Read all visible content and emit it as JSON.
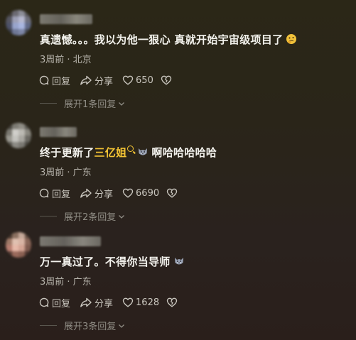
{
  "comments": [
    {
      "text": "真遗憾。。。我以为他一狠心 真就开始宇宙级项目了",
      "emoji": "thinking-face-emoji",
      "meta": "3周前 · 北京",
      "reply_label": "回复",
      "share_label": "分享",
      "likes": "650",
      "replies_label": "展开1条回复"
    },
    {
      "text_before": "终于更新了",
      "link_text": "三亿姐",
      "text_after": "啊哈哈哈哈哈",
      "emoji": "wolf-emoji",
      "meta": "3周前 · 广东",
      "reply_label": "回复",
      "share_label": "分享",
      "likes": "6690",
      "replies_label": "展开2条回复"
    },
    {
      "text": "万一真过了。不得你当导师",
      "emoji": "wolf-emoji",
      "meta": "3周前 · 广东",
      "reply_label": "回复",
      "share_label": "分享",
      "likes": "1628",
      "replies_label": "展开3条回复"
    }
  ],
  "colors": {
    "highlight": "#f5c534",
    "text": "#f2f1ec",
    "meta": "#b5b2aa",
    "muted": "#8f8c84"
  }
}
